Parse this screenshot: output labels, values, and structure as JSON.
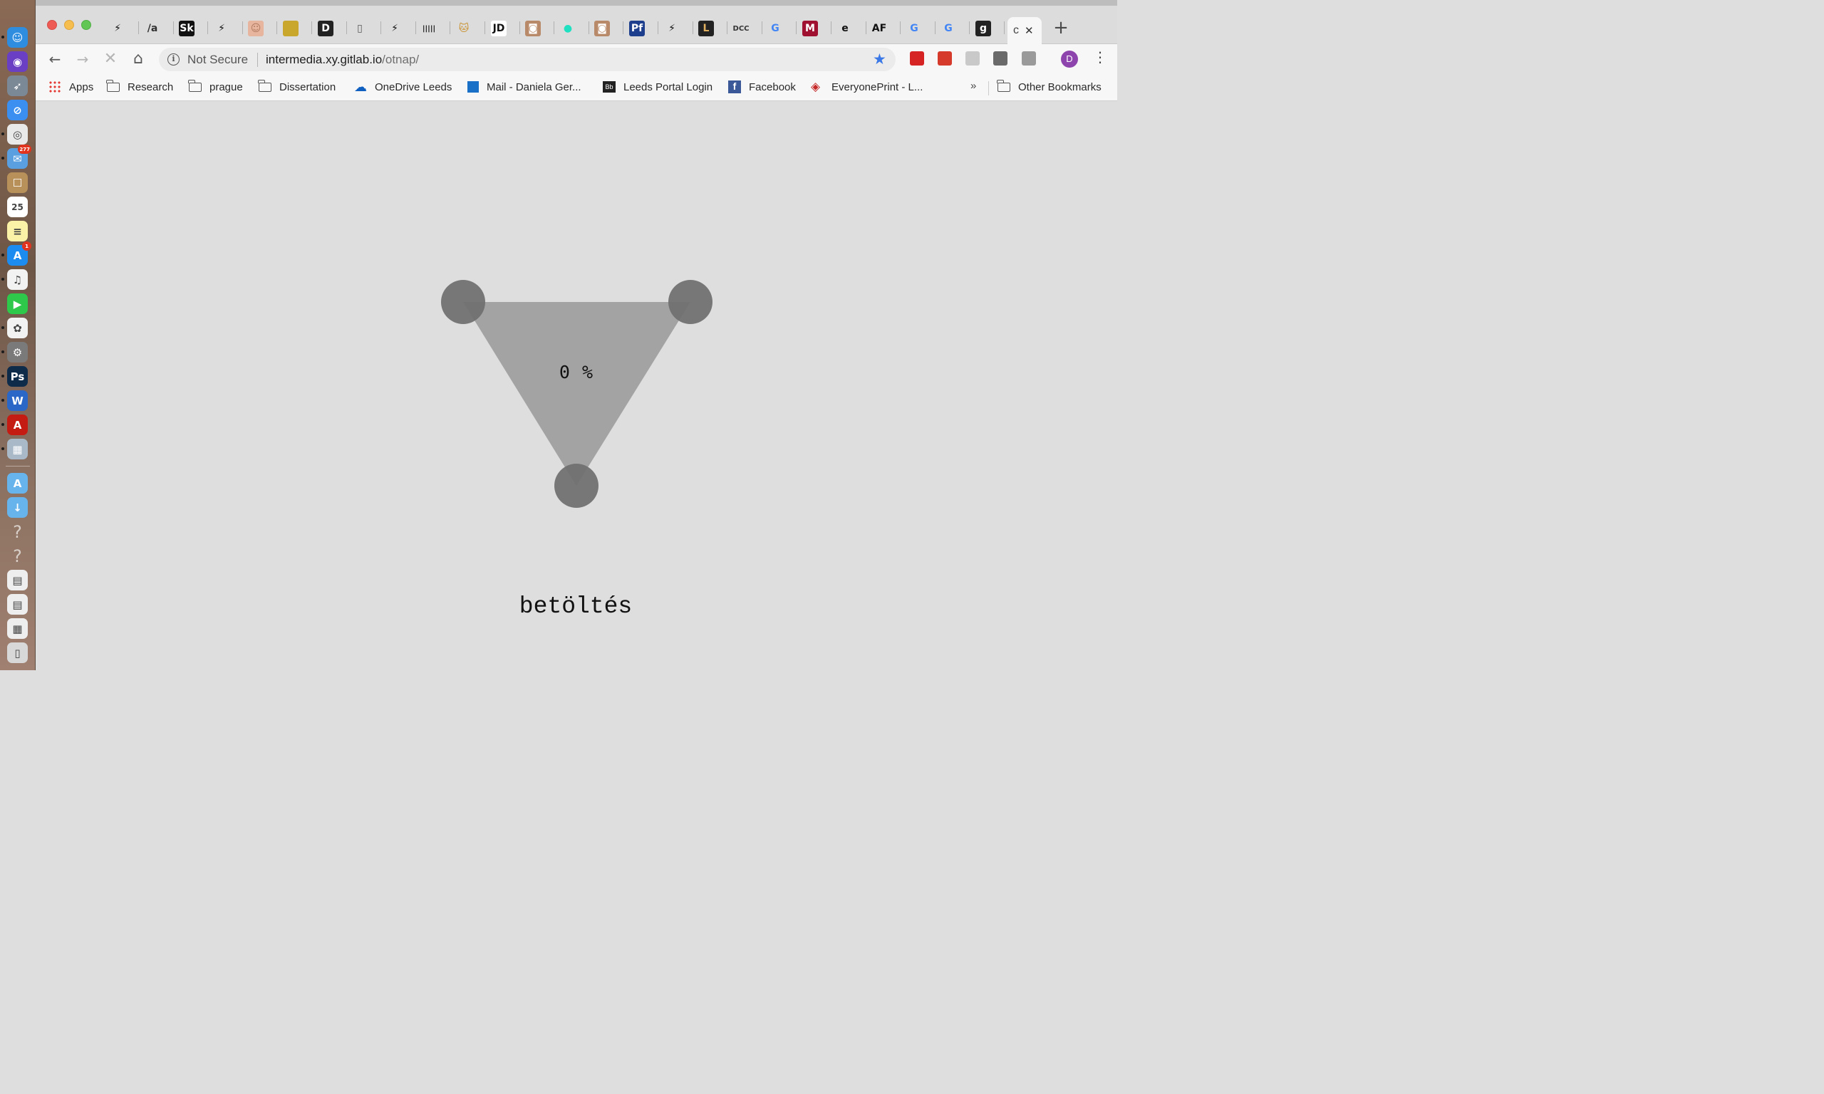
{
  "dock": {
    "items": [
      {
        "name": "finder-icon",
        "color": "#2f8de0",
        "glyph": "☺",
        "running": true
      },
      {
        "name": "siri-icon",
        "color": "#6a3fc4",
        "glyph": "◉",
        "running": false
      },
      {
        "name": "launchpad-icon",
        "color": "#7b8896",
        "glyph": "➶",
        "running": false
      },
      {
        "name": "safari-icon",
        "color": "#3a8ff0",
        "glyph": "⊘",
        "running": false
      },
      {
        "name": "chrome-icon",
        "color": "#e9e9e9",
        "glyph": "◎",
        "running": true
      },
      {
        "name": "mail-icon",
        "color": "#5aa0e0",
        "glyph": "✉",
        "running": true,
        "badge": "277"
      },
      {
        "name": "contacts-icon",
        "color": "#b8905a",
        "glyph": "☐",
        "running": false
      },
      {
        "name": "calendar-icon",
        "color": "#ffffff",
        "glyph": "25",
        "running": false
      },
      {
        "name": "notes-icon",
        "color": "#fbf2a8",
        "glyph": "≡",
        "running": false
      },
      {
        "name": "app-store-icon",
        "color": "#1d8cf0",
        "glyph": "A",
        "running": true,
        "badge": "1"
      },
      {
        "name": "itunes-icon",
        "color": "#f2f2f2",
        "glyph": "♫",
        "running": true
      },
      {
        "name": "facetime-icon",
        "color": "#2ec84a",
        "glyph": "▶",
        "running": false
      },
      {
        "name": "photos-icon",
        "color": "#f2f2f2",
        "glyph": "✿",
        "running": true
      },
      {
        "name": "system-preferences-icon",
        "color": "#7a7a7a",
        "glyph": "⚙",
        "running": true
      },
      {
        "name": "photoshop-icon",
        "color": "#0f2b4a",
        "glyph": "Ps",
        "running": true
      },
      {
        "name": "word-icon",
        "color": "#2b67c6",
        "glyph": "W",
        "running": true
      },
      {
        "name": "acrobat-icon",
        "color": "#c41c12",
        "glyph": "A",
        "running": true
      },
      {
        "name": "preview-icon",
        "color": "#a9b9c8",
        "glyph": "▦",
        "running": true
      },
      {
        "name": "applications-folder-icon",
        "color": "#67b3ec",
        "glyph": "A",
        "running": false
      },
      {
        "name": "downloads-folder-icon",
        "color": "#67b3ec",
        "glyph": "↓",
        "running": false
      },
      {
        "name": "unknown-app-icon-1",
        "color": "transparent",
        "glyph": "?",
        "running": false
      },
      {
        "name": "unknown-app-icon-2",
        "color": "transparent",
        "glyph": "?",
        "running": false
      },
      {
        "name": "document-stack-icon-1",
        "color": "#eeeeee",
        "glyph": "▤",
        "running": false
      },
      {
        "name": "document-stack-icon-2",
        "color": "#eeeeee",
        "glyph": "▤",
        "running": false
      },
      {
        "name": "document-stack-icon-3",
        "color": "#eeeeee",
        "glyph": "▦",
        "running": false
      },
      {
        "name": "trash-icon",
        "color": "#d8d8d8",
        "glyph": "▯",
        "running": false
      }
    ]
  },
  "tabs": [
    {
      "name": "tab-bolt-1",
      "glyph": "⚡",
      "bg": "transparent",
      "fg": "#111"
    },
    {
      "name": "tab-slash-a",
      "glyph": "/a",
      "bg": "transparent",
      "fg": "#333"
    },
    {
      "name": "tab-sk",
      "glyph": "Sk",
      "bg": "#111",
      "fg": "#fff"
    },
    {
      "name": "tab-bolt-2",
      "glyph": "⚡",
      "bg": "transparent",
      "fg": "#111"
    },
    {
      "name": "tab-face",
      "glyph": "☺",
      "bg": "#e7b49d",
      "fg": "#b07a60"
    },
    {
      "name": "tab-gold",
      "glyph": "",
      "bg": "#c9a72c",
      "fg": "#fff"
    },
    {
      "name": "tab-d",
      "glyph": "D",
      "bg": "#222",
      "fg": "#fff"
    },
    {
      "name": "tab-doc",
      "glyph": "▯",
      "bg": "transparent",
      "fg": "#555"
    },
    {
      "name": "tab-bolt-3",
      "glyph": "⚡",
      "bg": "transparent",
      "fg": "#111"
    },
    {
      "name": "tab-barcode",
      "glyph": "|||||",
      "bg": "transparent",
      "fg": "#111"
    },
    {
      "name": "tab-cat",
      "glyph": "🐱",
      "bg": "transparent",
      "fg": "#c9902c"
    },
    {
      "name": "tab-jd",
      "glyph": "JD",
      "bg": "#fff",
      "fg": "#111"
    },
    {
      "name": "tab-photo-1",
      "glyph": "◙",
      "bg": "#b88a6a",
      "fg": "#fff"
    },
    {
      "name": "tab-teal-dot",
      "glyph": "●",
      "bg": "transparent",
      "fg": "#1fe0c0"
    },
    {
      "name": "tab-photo-2",
      "glyph": "◙",
      "bg": "#b88a6a",
      "fg": "#fff"
    },
    {
      "name": "tab-pf",
      "glyph": "Pf",
      "bg": "#1c3e8c",
      "fg": "#fff"
    },
    {
      "name": "tab-bolt-4",
      "glyph": "⚡",
      "bg": "transparent",
      "fg": "#111"
    },
    {
      "name": "tab-l",
      "glyph": "L",
      "bg": "#222",
      "fg": "#e0b060"
    },
    {
      "name": "tab-dcc",
      "glyph": "DCC",
      "bg": "transparent",
      "fg": "#333"
    },
    {
      "name": "tab-google-1",
      "glyph": "G",
      "bg": "transparent",
      "fg": "#4285f4"
    },
    {
      "name": "tab-m",
      "glyph": "M",
      "bg": "#a01030",
      "fg": "#fff"
    },
    {
      "name": "tab-e",
      "glyph": "e",
      "bg": "transparent",
      "fg": "#111"
    },
    {
      "name": "tab-af",
      "glyph": "AF",
      "bg": "transparent",
      "fg": "#111"
    },
    {
      "name": "tab-google-2",
      "glyph": "G",
      "bg": "transparent",
      "fg": "#4285f4"
    },
    {
      "name": "tab-google-3",
      "glyph": "G",
      "bg": "transparent",
      "fg": "#4285f4"
    },
    {
      "name": "tab-g-dark",
      "glyph": "g",
      "bg": "#222",
      "fg": "#fff"
    }
  ],
  "active_tab": {
    "glyph": "c",
    "close": "✕"
  },
  "toolbar": {
    "back": "←",
    "forward": "→",
    "stop": "✕",
    "home": "⌂",
    "security_label": "Not Secure",
    "url_host": "intermedia.xy.gitlab.io",
    "url_path": "/otnap/",
    "star": "★",
    "profile_initial": "D",
    "menu": "⋮"
  },
  "extensions": [
    {
      "name": "adblock-extension-icon",
      "color": "#d62424"
    },
    {
      "name": "bookmark-extension-icon",
      "color": "#d63a2a"
    },
    {
      "name": "comment-extension-icon",
      "color": "#c9c9c9"
    },
    {
      "name": "screenshot-extension-icon",
      "color": "#6a6a6a"
    },
    {
      "name": "facebook-extension-icon",
      "color": "#9a9a9a"
    }
  ],
  "bookmarks": {
    "items": [
      {
        "name": "bookmark-apps",
        "label": "Apps",
        "icon": "apps"
      },
      {
        "name": "bookmark-research",
        "label": "Research",
        "icon": "folder"
      },
      {
        "name": "bookmark-prague",
        "label": "prague",
        "icon": "folder"
      },
      {
        "name": "bookmark-dissertation",
        "label": "Dissertation",
        "icon": "folder"
      },
      {
        "name": "bookmark-onedrive-leeds",
        "label": "OneDrive Leeds",
        "icon": "cloud"
      },
      {
        "name": "bookmark-mail",
        "label": "Mail - Daniela Ger...",
        "icon": "outlook"
      },
      {
        "name": "bookmark-leeds-portal",
        "label": "Leeds Portal Login",
        "icon": "bb"
      },
      {
        "name": "bookmark-facebook",
        "label": "Facebook",
        "icon": "facebook"
      },
      {
        "name": "bookmark-everyoneprint",
        "label": "EveryonePrint - L...",
        "icon": "print"
      }
    ],
    "more": "»",
    "other_label": "Other Bookmarks"
  },
  "page": {
    "progress_text": "0 %",
    "loading_label": "betöltés"
  }
}
